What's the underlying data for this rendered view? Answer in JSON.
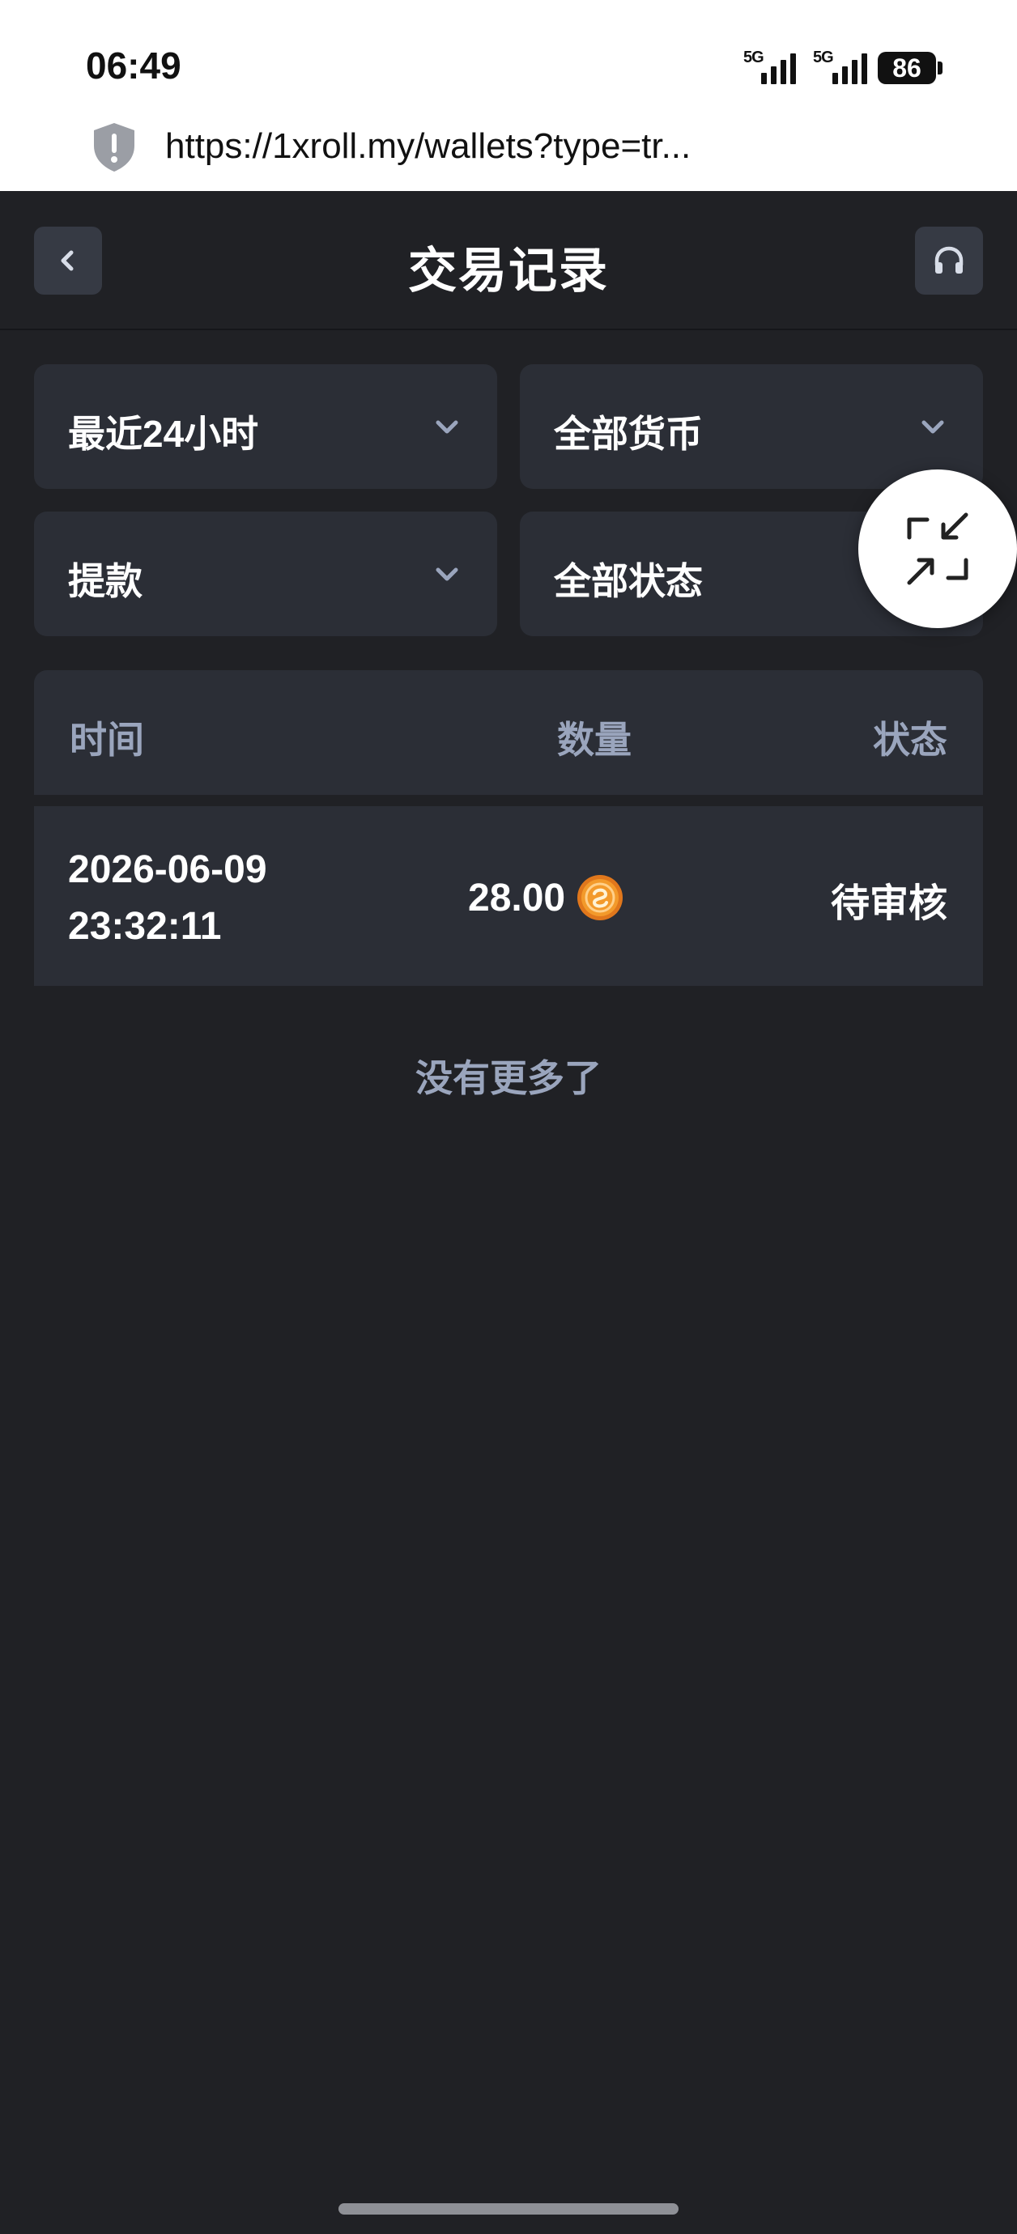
{
  "status_bar": {
    "time": "06:49",
    "signal_1_label": "5G",
    "signal_2_label": "5G",
    "battery": "86"
  },
  "browser": {
    "url": "https://1xroll.my/wallets?type=tr..."
  },
  "header": {
    "title": "交易记录"
  },
  "filters": {
    "period": "最近24小时",
    "currency": "全部货币",
    "type": "提款",
    "status": "全部状态"
  },
  "table": {
    "columns": {
      "time": "时间",
      "quantity": "数量",
      "status": "状态"
    },
    "rows": [
      {
        "date": "2026-06-09",
        "time": "23:32:11",
        "amount": "28.00",
        "status": "待审核"
      }
    ]
  },
  "footer_text": "没有更多了",
  "colors": {
    "background": "#202125",
    "card": "#2b2e36",
    "muted_text": "#9aa5bd",
    "coin": "#f39a2b"
  }
}
